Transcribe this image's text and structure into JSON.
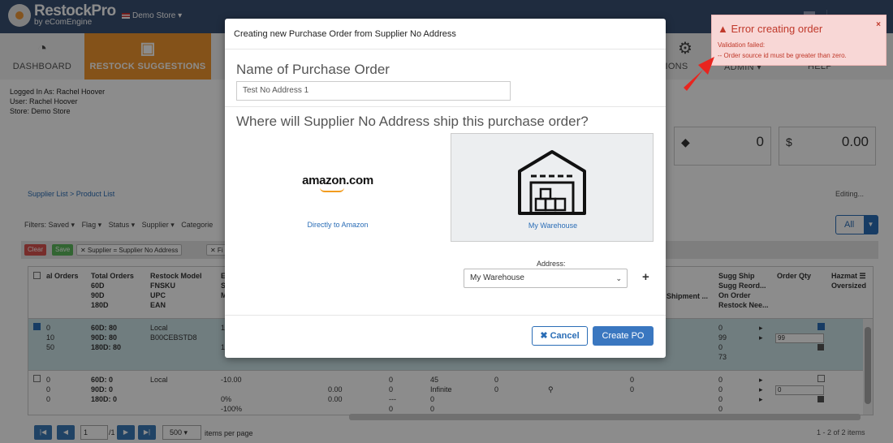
{
  "app": {
    "logo_name": "RestockPro",
    "logo_sub": "by eComEngine",
    "store_selector": "Demo Store ▾"
  },
  "nav": {
    "dashboard": "DASHBOARD",
    "restock": "RESTOCK SUGGESTIONS",
    "ations": "TIONS",
    "admin": "ADMIN ▾",
    "help": "HELP"
  },
  "login": {
    "line1": "Logged In As: Rachel Hoover",
    "line2": "User: Rachel Hoover",
    "line3": "Store: Demo Store"
  },
  "stats": [
    {
      "icon": "tag-icon",
      "value": "0"
    },
    {
      "icon": "dollar-icon",
      "value": "0.00"
    }
  ],
  "breadcrumb": "Supplier List > Product List",
  "editing": "Editing...",
  "filters": [
    "Filters: Saved ▾",
    "Flag ▾",
    "Status ▾",
    "Supplier ▾",
    "Categorie"
  ],
  "all_button": "All",
  "chips": {
    "clear": "Clear",
    "save": "Save",
    "supplier": "✕ Supplier = Supplier No Address",
    "f2": "✕ Fi"
  },
  "grid": {
    "headers": {
      "orders": "al Orders",
      "total_orders": "Total Orders\n60D\n90D\n180D",
      "restock_model": "Restock Model\nFNSKU\nUPC\nEAN",
      "col_e": "E\nS\nM",
      "shipment": "Shipment ...",
      "sugg_ship": "Sugg Ship\nSugg Reord...\nOn Order\nRestock Nee...",
      "order_qty": "Order Qty",
      "hazmat": "Hazmat ☰\nOversized"
    },
    "row1": {
      "orders": "0\n10\n50",
      "total_orders": "60D: 80\n90D: 80\n180D: 80",
      "model": "Local\nB00CEBSTD8",
      "col_e": "17\n\n16",
      "sugg": "0\n99\n0\n73",
      "qty": "99"
    },
    "row2": {
      "orders": "0\n0\n0",
      "total_orders": "60D: 0\n90D: 0\n180D: 0",
      "model": "Local",
      "col_e": "-10.00\n\n0%\n-100%",
      "c5": "0.00\n0.00",
      "c6": "0\n0\n---\n0",
      "c7": "45\nInfinite\n0\n0",
      "c8": "0\n0",
      "c10": "0\n0",
      "sugg": "0\n0\n0\n0",
      "qty": "0"
    }
  },
  "pager": {
    "page": "1",
    "of": "/1",
    "size": "500",
    "items_per_page": "items per page",
    "count": "1 - 2 of 2 items"
  },
  "modal": {
    "title": "Creating new Purchase Order from Supplier No Address",
    "name_heading": "Name of Purchase Order",
    "name_value": "Test No Address 1",
    "ship_heading": "Where will Supplier No Address ship this purchase order?",
    "amazon_logo": "amazon.com",
    "amazon_label": "Directly to Amazon",
    "warehouse_label": "My Warehouse",
    "address_label": "Address:",
    "address_value": "My Warehouse",
    "cancel": "✖ Cancel",
    "create": "Create PO"
  },
  "toast": {
    "title": "Error creating order",
    "line1": "Validation failed:",
    "line2": "-- Order source id must be greater than zero.",
    "close": "×"
  },
  "colors": {
    "topbar": "#3a5073",
    "accent": "#f0962e",
    "primary": "#3a77c0",
    "error": "#c0392b",
    "arrow": "#e8251f"
  }
}
